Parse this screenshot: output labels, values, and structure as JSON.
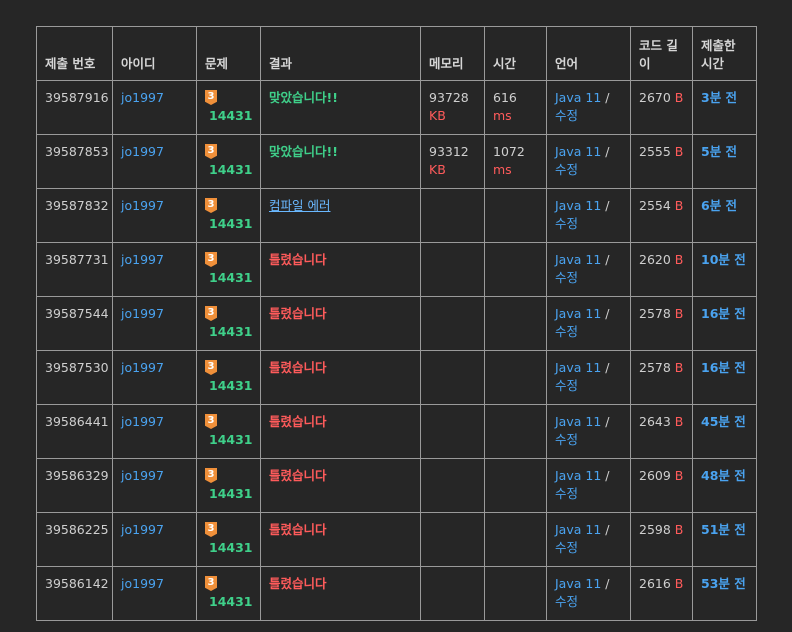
{
  "headers": {
    "id": "제출 번호",
    "user": "아이디",
    "problem": "문제",
    "result": "결과",
    "memory": "메모리",
    "time": "시간",
    "lang": "언어",
    "code_len": "코드 길이",
    "submitted": "제출한 시간"
  },
  "rows": [
    {
      "id": "39587916",
      "user": "jo1997",
      "tier": "3",
      "problem": "14431",
      "result": "맞았습니다!!",
      "status": "ok",
      "memory": "93728",
      "memory_unit": "KB",
      "time": "616",
      "time_unit": "ms",
      "lang": "Java 11",
      "edit": "수정",
      "slash": "/",
      "code": "2670",
      "code_unit": "B",
      "ago": "3분 전"
    },
    {
      "id": "39587853",
      "user": "jo1997",
      "tier": "3",
      "problem": "14431",
      "result": "맞았습니다!!",
      "status": "ok",
      "memory": "93312",
      "memory_unit": "KB",
      "time": "1072",
      "time_unit": "ms",
      "lang": "Java 11",
      "edit": "수정",
      "slash": "/",
      "code": "2555",
      "code_unit": "B",
      "ago": "5분 전"
    },
    {
      "id": "39587832",
      "user": "jo1997",
      "tier": "3",
      "problem": "14431",
      "result": "컴파일 에러",
      "status": "ce",
      "memory": "",
      "memory_unit": "",
      "time": "",
      "time_unit": "",
      "lang": "Java 11",
      "edit": "수정",
      "slash": "/",
      "code": "2554",
      "code_unit": "B",
      "ago": "6분 전"
    },
    {
      "id": "39587731",
      "user": "jo1997",
      "tier": "3",
      "problem": "14431",
      "result": "틀렸습니다",
      "status": "wa",
      "memory": "",
      "memory_unit": "",
      "time": "",
      "time_unit": "",
      "lang": "Java 11",
      "edit": "수정",
      "slash": "/",
      "code": "2620",
      "code_unit": "B",
      "ago": "10분 전"
    },
    {
      "id": "39587544",
      "user": "jo1997",
      "tier": "3",
      "problem": "14431",
      "result": "틀렸습니다",
      "status": "wa",
      "memory": "",
      "memory_unit": "",
      "time": "",
      "time_unit": "",
      "lang": "Java 11",
      "edit": "수정",
      "slash": "/",
      "code": "2578",
      "code_unit": "B",
      "ago": "16분 전"
    },
    {
      "id": "39587530",
      "user": "jo1997",
      "tier": "3",
      "problem": "14431",
      "result": "틀렸습니다",
      "status": "wa",
      "memory": "",
      "memory_unit": "",
      "time": "",
      "time_unit": "",
      "lang": "Java 11",
      "edit": "수정",
      "slash": "/",
      "code": "2578",
      "code_unit": "B",
      "ago": "16분 전"
    },
    {
      "id": "39586441",
      "user": "jo1997",
      "tier": "3",
      "problem": "14431",
      "result": "틀렸습니다",
      "status": "wa",
      "memory": "",
      "memory_unit": "",
      "time": "",
      "time_unit": "",
      "lang": "Java 11",
      "edit": "수정",
      "slash": "/",
      "code": "2643",
      "code_unit": "B",
      "ago": "45분 전"
    },
    {
      "id": "39586329",
      "user": "jo1997",
      "tier": "3",
      "problem": "14431",
      "result": "틀렸습니다",
      "status": "wa",
      "memory": "",
      "memory_unit": "",
      "time": "",
      "time_unit": "",
      "lang": "Java 11",
      "edit": "수정",
      "slash": "/",
      "code": "2609",
      "code_unit": "B",
      "ago": "48분 전"
    },
    {
      "id": "39586225",
      "user": "jo1997",
      "tier": "3",
      "problem": "14431",
      "result": "틀렸습니다",
      "status": "wa",
      "memory": "",
      "memory_unit": "",
      "time": "",
      "time_unit": "",
      "lang": "Java 11",
      "edit": "수정",
      "slash": "/",
      "code": "2598",
      "code_unit": "B",
      "ago": "51분 전"
    },
    {
      "id": "39586142",
      "user": "jo1997",
      "tier": "3",
      "problem": "14431",
      "result": "틀렸습니다",
      "status": "wa",
      "memory": "",
      "memory_unit": "",
      "time": "",
      "time_unit": "",
      "lang": "Java 11",
      "edit": "수정",
      "slash": "/",
      "code": "2616",
      "code_unit": "B",
      "ago": "53분 전"
    }
  ],
  "colors": {
    "accepted": "#3fd08a",
    "wrong": "#ff5b5b",
    "link": "#4aa3f0",
    "tier_bronze": "#f0903a"
  }
}
